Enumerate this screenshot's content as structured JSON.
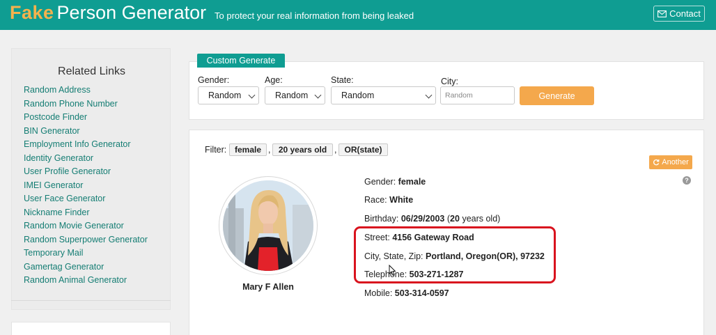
{
  "header": {
    "logo_fake": "Fake",
    "logo_name": "Person Generator",
    "tagline": "To protect your real information from being leaked",
    "contact_label": "Contact",
    "contact_icon": "mail-icon"
  },
  "sidebar": {
    "title": "Related Links",
    "links": [
      "Random Address",
      "Random Phone Number",
      "Postcode Finder",
      "BIN Generator",
      "Employment Info Generator",
      "Identity Generator",
      "User Profile Generator",
      "IMEI Generator",
      "User Face Generator",
      "Nickname Finder",
      "Random Movie Generator",
      "Random Superpower Generator",
      "Temporary Mail",
      "Gamertag Generator",
      "Random Animal Generator"
    ]
  },
  "custom": {
    "tab_label": "Custom Generate",
    "gender_label": "Gender:",
    "gender_value": "Random",
    "age_label": "Age:",
    "age_value": "Random",
    "state_label": "State:",
    "state_value": "Random",
    "city_label": "City:",
    "city_placeholder": "Random",
    "generate_label": "Generate"
  },
  "result": {
    "filter_label": "Filter:",
    "filters": [
      "female",
      "20 years old",
      "OR(state)"
    ],
    "another_label": "Another",
    "help_glyph": "?",
    "name": "Mary F Allen",
    "details": {
      "gender_label": "Gender:",
      "gender": "female",
      "race_label": "Race:",
      "race": "White",
      "birthday_label": "Birthday:",
      "birthday": "06/29/2003",
      "age_prefix": "(",
      "age": "20",
      "age_suffix": "years old)",
      "street_label": "Street:",
      "street": "4156 Gateway Road",
      "city_label": "City, State, Zip:",
      "city": "Portland, Oregon(OR), 97232",
      "telephone_label": "Telephone:",
      "telephone": "503-271-1287",
      "mobile_label": "Mobile:",
      "mobile": "503-314-0597"
    }
  },
  "colors": {
    "brand_teal": "#0f9d92",
    "accent_orange": "#f4a84c",
    "highlight_red": "#d9131e",
    "link_teal": "#147d73"
  }
}
